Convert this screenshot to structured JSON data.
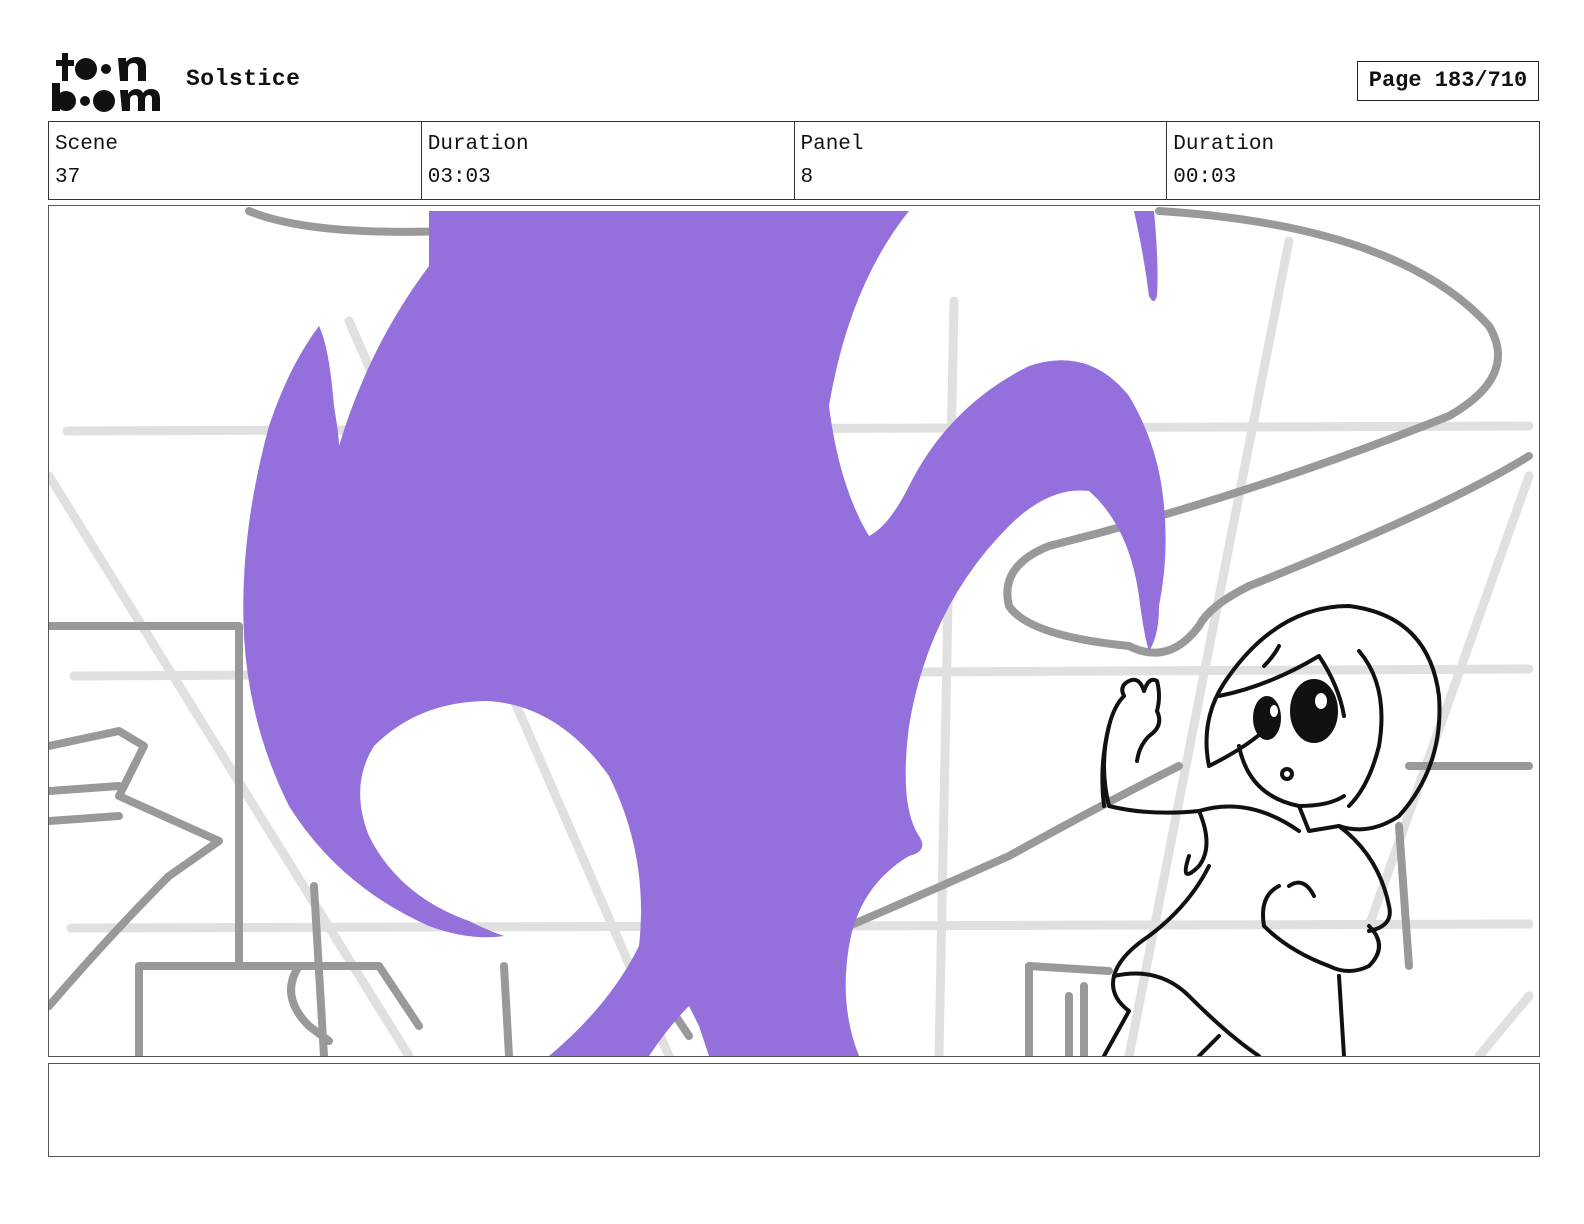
{
  "header": {
    "logo_text": "toon boom",
    "project_title": "Solstice",
    "page_indicator": "Page 183/710"
  },
  "info": {
    "scene_label": "Scene",
    "scene_value": "37",
    "scene_duration_label": "Duration",
    "scene_duration_value": "03:03",
    "panel_label": "Panel",
    "panel_value": "8",
    "panel_duration_label": "Duration",
    "panel_duration_value": "00:03"
  },
  "drawing": {
    "colors": {
      "magic_blast": "#9370DB",
      "background_lines": "#999999",
      "light_lines": "#e0e0e0",
      "character_lines": "#111111"
    }
  },
  "notes": {
    "text": ""
  }
}
